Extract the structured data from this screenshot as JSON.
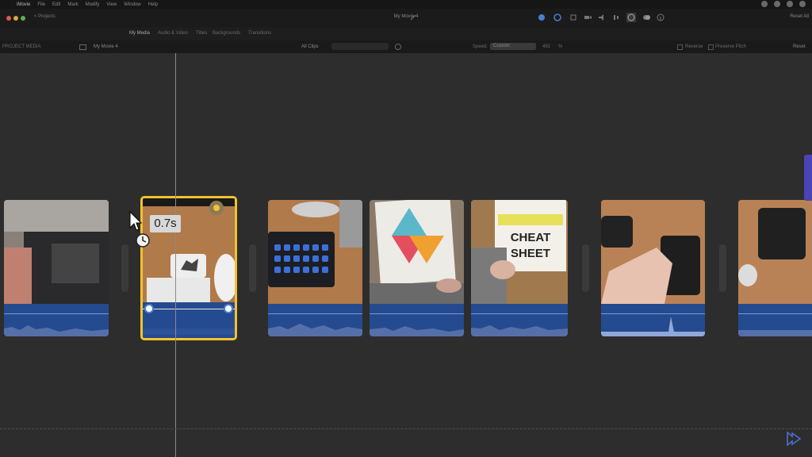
{
  "menu": {
    "apple": "",
    "items": [
      "iMovie",
      "File",
      "Edit",
      "Mark",
      "Modify",
      "View",
      "Window",
      "Help"
    ]
  },
  "toolbar": {
    "projects_label": "< Projects",
    "window_title": "My Movie 4",
    "reset_all": "Reset All"
  },
  "browser_tabs": [
    "My Media",
    "Audio & Video",
    "Titles",
    "Backgrounds",
    "Transitions"
  ],
  "active_tab": "My Media",
  "project": {
    "media_label": "PROJECT MEDIA",
    "name": "My Movie 4",
    "filter": "All Clips"
  },
  "speed_controls": {
    "speed_label": "Speed:",
    "speed_value": "Custom",
    "percent": "492",
    "percent_unit": "%",
    "reverse_label": "Reverse",
    "preserve_pitch_label": "Preserve Pitch",
    "reset": "Reset"
  },
  "timeline": {
    "speed_tooltip": "0.7s"
  },
  "colors": {
    "selection": "#f2c230",
    "audio": "#244a8f",
    "accent": "#4a44b8"
  }
}
